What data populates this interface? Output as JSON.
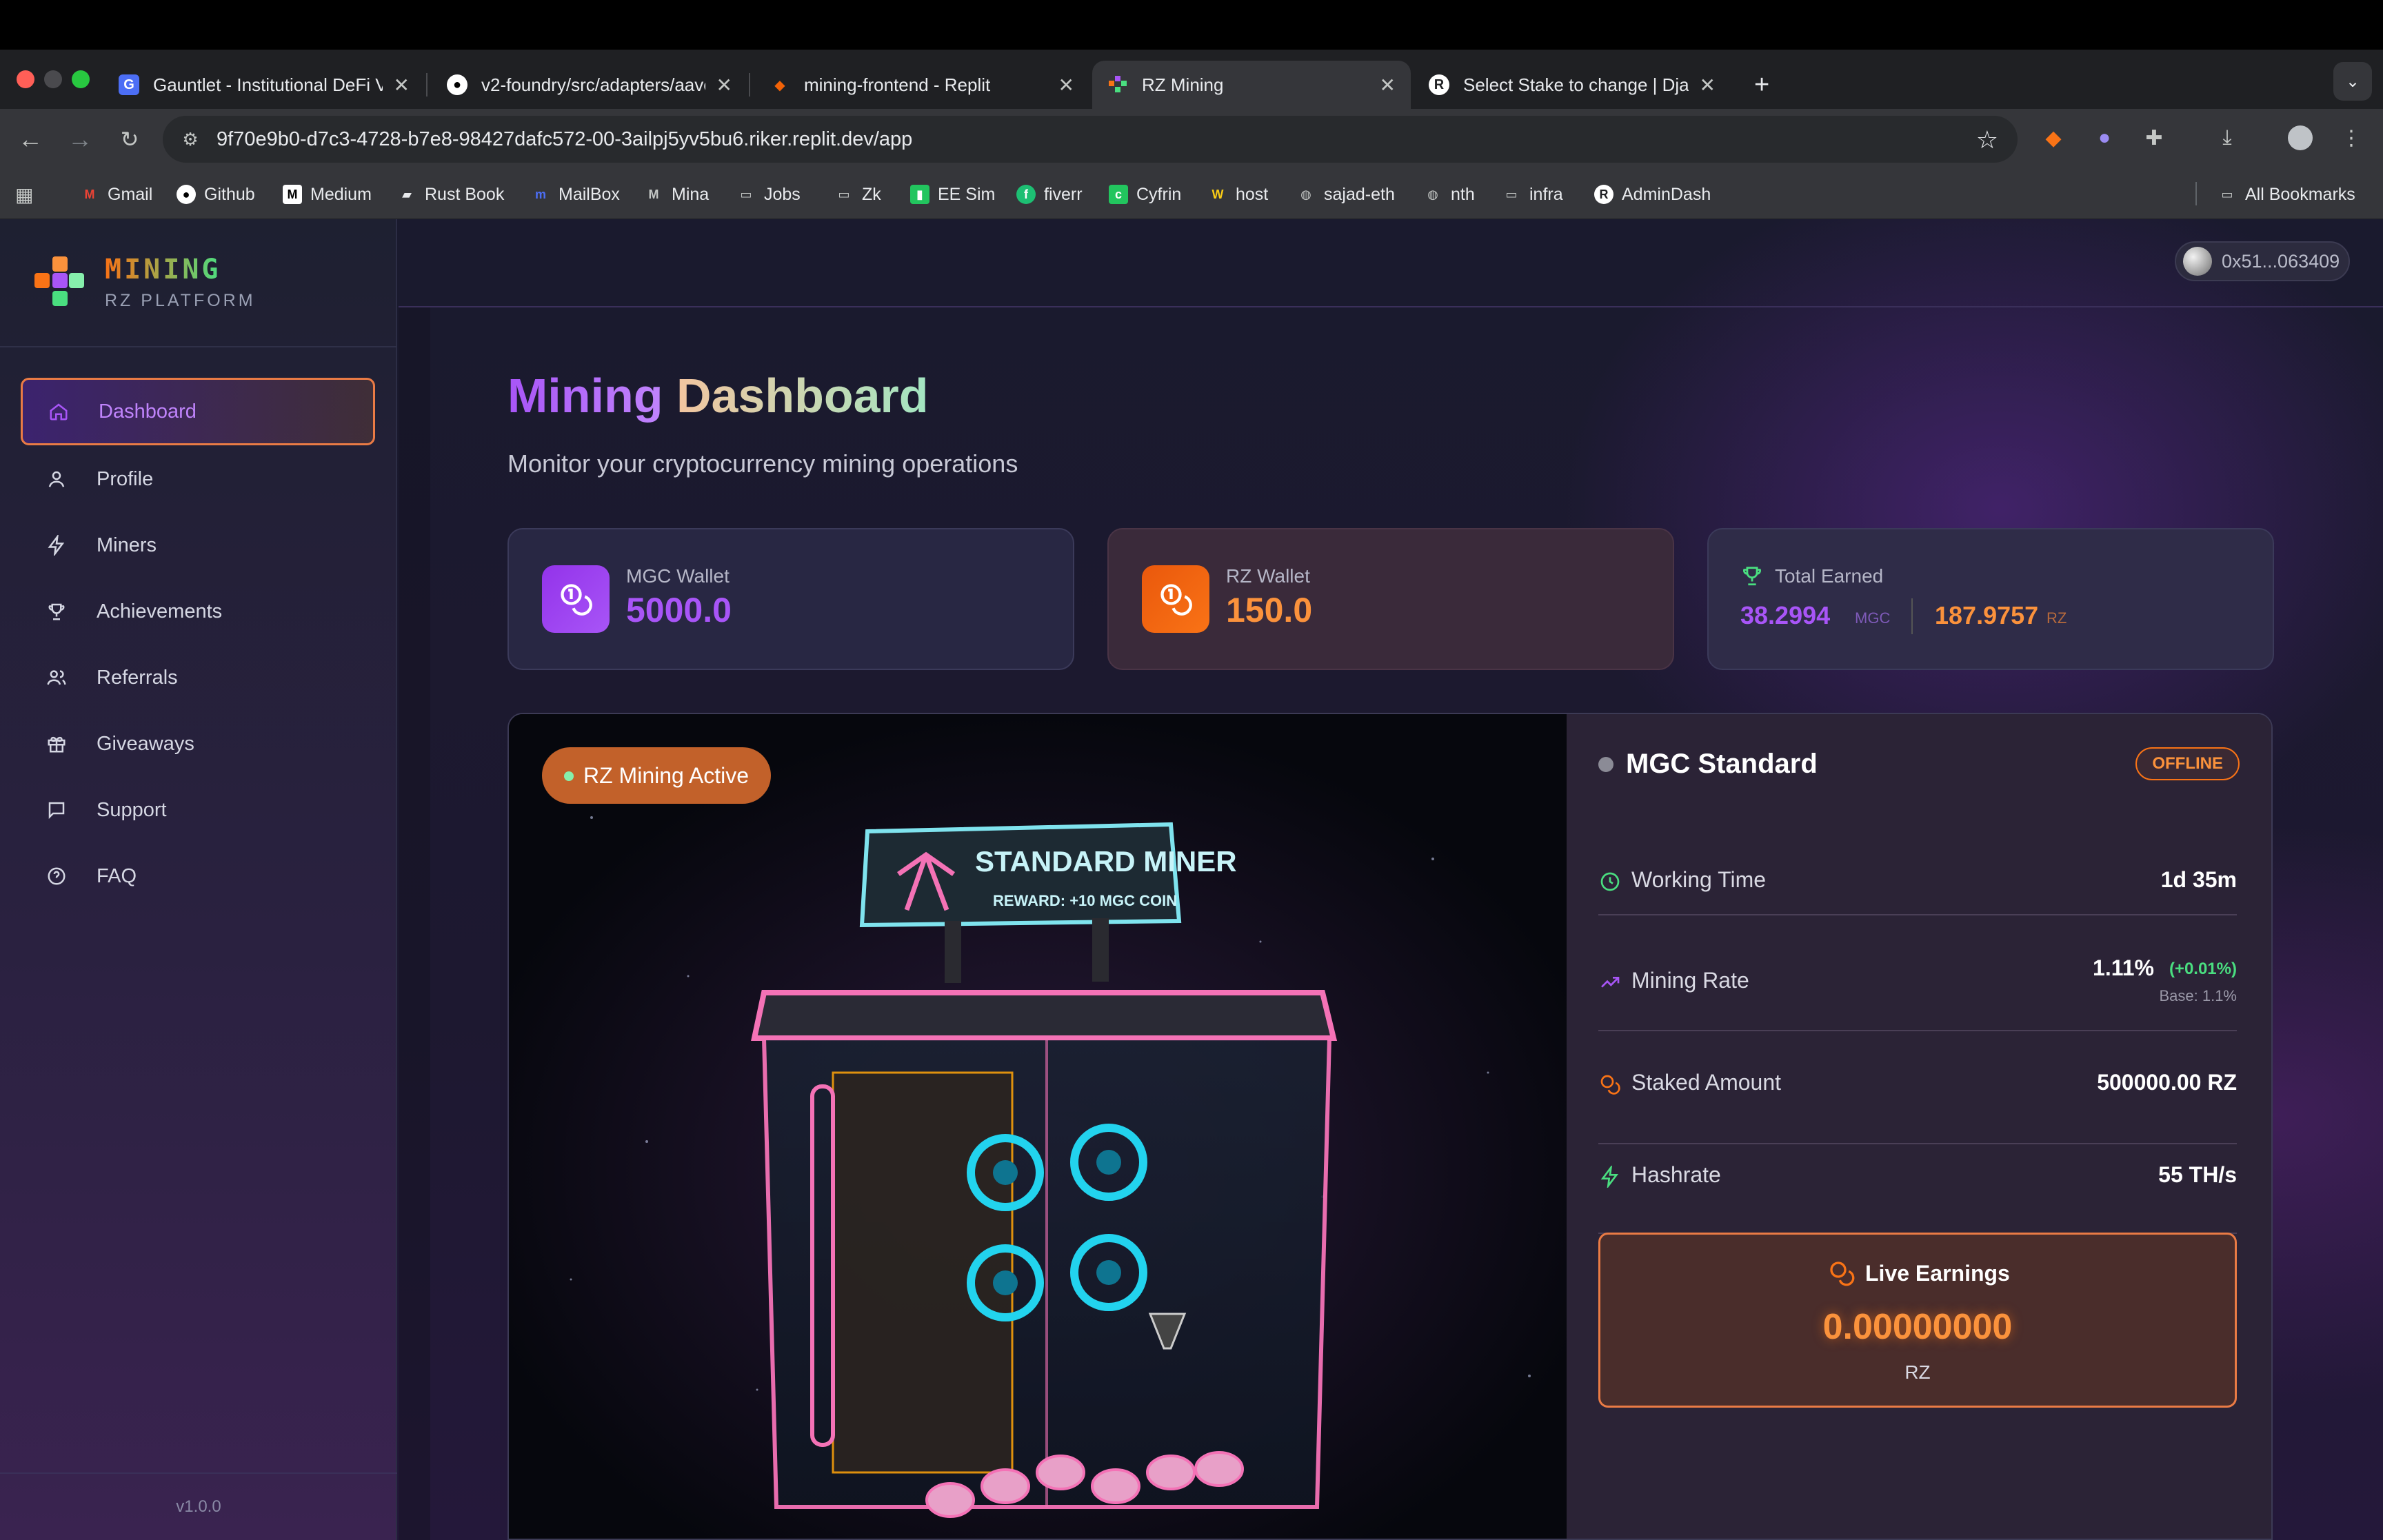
{
  "browser": {
    "tabs": [
      {
        "title": "Gauntlet - Institutional DeFi V"
      },
      {
        "title": "v2-foundry/src/adapters/aave"
      },
      {
        "title": "mining-frontend - Replit"
      },
      {
        "title": "RZ Mining"
      },
      {
        "title": "Select Stake to change | Djan"
      }
    ],
    "url": "9f70e9b0-d7c3-4728-b7e8-98427dafc572-00-3ailpj5yv5bu6.riker.replit.dev/app",
    "bookmarks": [
      "Gmail",
      "Github",
      "Medium",
      "Rust Book",
      "MailBox",
      "Mina",
      "Jobs",
      "Zk",
      "EE Sim",
      "fiverr",
      "Cyfrin",
      "host",
      "sajad-eth",
      "nth",
      "infra",
      "AdminDash"
    ],
    "all_bookmarks": "All Bookmarks"
  },
  "sidebar": {
    "brand_title": "MINING",
    "brand_subtitle": "RZ PLATFORM",
    "items": [
      {
        "label": "Dashboard",
        "icon": "home-icon",
        "active": true
      },
      {
        "label": "Profile",
        "icon": "user-icon"
      },
      {
        "label": "Miners",
        "icon": "bolt-icon"
      },
      {
        "label": "Achievements",
        "icon": "trophy-icon"
      },
      {
        "label": "Referrals",
        "icon": "users-icon"
      },
      {
        "label": "Giveaways",
        "icon": "gift-icon"
      },
      {
        "label": "Support",
        "icon": "message-icon"
      },
      {
        "label": "FAQ",
        "icon": "help-circle-icon"
      }
    ],
    "version": "v1.0.0"
  },
  "header": {
    "wallet_address": "0x51...063409"
  },
  "page": {
    "title_part1": "Mining",
    "title_part2": "Dashboard",
    "subtitle": "Monitor your cryptocurrency mining operations"
  },
  "cards": {
    "mgc": {
      "label": "MGC Wallet",
      "value": "5000.0",
      "color": "#a855f7"
    },
    "rz": {
      "label": "RZ Wallet",
      "value": "150.0",
      "color": "#f97316"
    },
    "total": {
      "label": "Total Earned",
      "mgc_value": "38.2994",
      "mgc_unit": "MGC",
      "rz_value": "187.9757",
      "rz_unit": "RZ"
    }
  },
  "miner": {
    "badge": "RZ Mining Active",
    "sign_title": "STANDARD MINER",
    "sign_reward": "REWARD: +10 MGC COIN",
    "name": "MGC Standard",
    "status": "OFFLINE",
    "rows": {
      "working_time": {
        "label": "Working Time",
        "value": "1d 35m"
      },
      "mining_rate": {
        "label": "Mining Rate",
        "value": "1.11%",
        "delta": "(+0.01%)",
        "base": "Base: 1.1%"
      },
      "staked": {
        "label": "Staked Amount",
        "value": "500000.00 RZ"
      },
      "hashrate": {
        "label": "Hashrate",
        "value": "55 TH/s"
      }
    },
    "live": {
      "title": "Live Earnings",
      "value": "0.00000000",
      "unit": "RZ"
    }
  }
}
